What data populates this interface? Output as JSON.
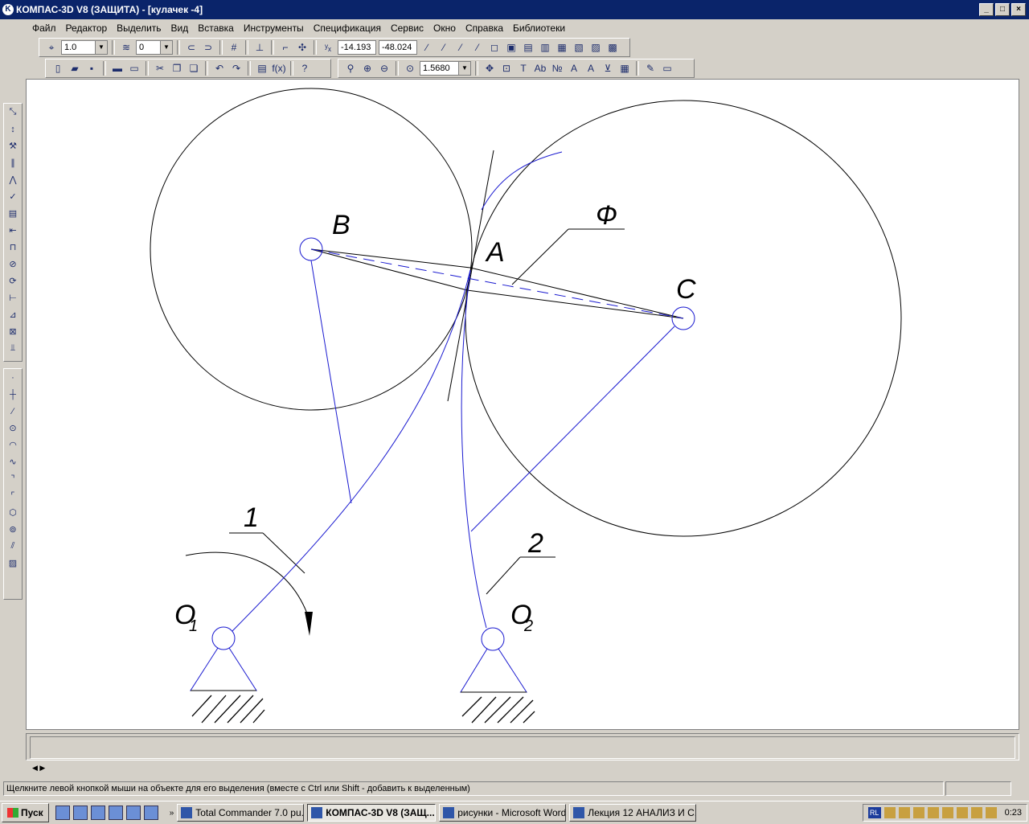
{
  "window": {
    "title": "КОМПАС-3D V8 (ЗАЩИТА) - [кулачек -4]"
  },
  "menu": [
    "Файл",
    "Редактор",
    "Выделить",
    "Вид",
    "Вставка",
    "Инструменты",
    "Спецификация",
    "Сервис",
    "Окно",
    "Справка",
    "Библиотеки"
  ],
  "toolbar": {
    "step": "1.0",
    "layer": "0",
    "coord_x": "-14.193",
    "coord_y": "-48.024",
    "zoom": "1.5680"
  },
  "drawing": {
    "labels": {
      "B": "B",
      "A": "A",
      "C": "C",
      "phi": "Ф",
      "one": "1",
      "two": "2",
      "o1": "O",
      "o1_sub": "1",
      "o2": "O",
      "o2_sub": "2"
    }
  },
  "status": "Щелкните левой кнопкой мыши на объекте для его выделения (вместе с Ctrl или Shift - добавить к выделенным)",
  "taskbar": {
    "start": "Пуск",
    "tasks": [
      "Total Commander 7.0 pu...",
      "КОМПАС-3D V8 (ЗАЩ...",
      "рисунки - Microsoft Word",
      "Лекция 12 АНАЛИЗ И С..."
    ],
    "lang": "RL",
    "clock": "0:23"
  },
  "colors": {
    "titlebar": "#0a246a",
    "drawing_blue": "#1a1ad0",
    "drawing_black": "#000000"
  }
}
